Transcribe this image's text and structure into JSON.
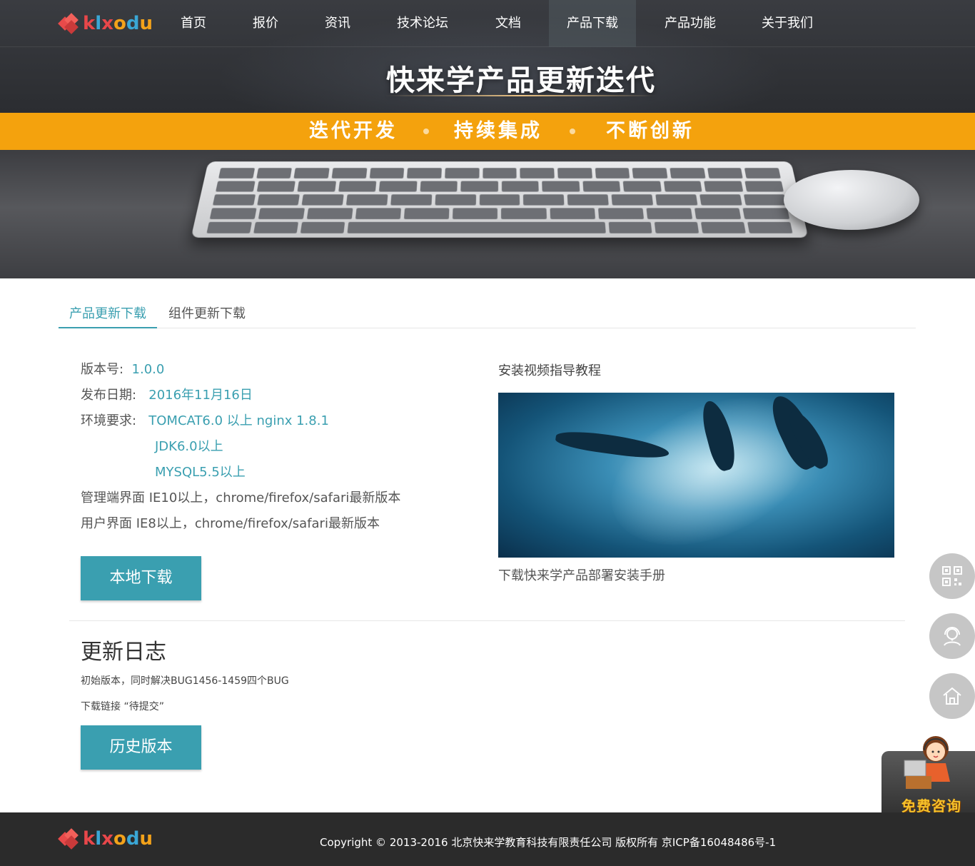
{
  "brand": {
    "logo_text": "klxodu"
  },
  "nav": {
    "items": [
      {
        "label": "首页"
      },
      {
        "label": "报价"
      },
      {
        "label": "资讯"
      },
      {
        "label": "技术论坛"
      },
      {
        "label": "文档"
      },
      {
        "label": "产品下载",
        "active": true
      },
      {
        "label": "产品功能"
      },
      {
        "label": "关于我们"
      }
    ]
  },
  "banner": {
    "title": "快来学产品更新迭代",
    "slogans": [
      "迭代开发",
      "持续集成",
      "不断创新"
    ],
    "accent_color": "#f4a20d"
  },
  "tabs": [
    {
      "label": "产品更新下载",
      "active": true
    },
    {
      "label": "组件更新下载"
    }
  ],
  "version_info": {
    "version_label": "版本号:",
    "version_value": "1.0.0",
    "date_label": "发布日期:",
    "date_value": "2016年11月16日",
    "env_label": "环境要求:",
    "env_values": [
      "TOMCAT6.0 以上 nginx 1.8.1",
      "JDK6.0以上",
      "MYSQL5.5以上"
    ],
    "admin_ui": "管理端界面 IE10以上，chrome/firefox/safari最新版本",
    "user_ui": "用户界面 IE8以上，chrome/firefox/safari最新版本",
    "download_button": "本地下载"
  },
  "video": {
    "title": "安装视频指导教程",
    "caption": "下载快来学产品部署安装手册"
  },
  "changelog": {
    "title": "更新日志",
    "lines": [
      "初始版本，同时解决BUG1456-1459四个BUG",
      "下载链接 “待提交”"
    ],
    "history_button": "历史版本"
  },
  "side": {
    "icons": [
      "qrcode-icon",
      "customer-service-icon",
      "home-icon"
    ],
    "consult_label": "免费咨询"
  },
  "footer": {
    "copyright": "Copyright © 2013-2016  北京快来学教育科技有限责任公司 版权所有    京ICP备16048486号-1"
  },
  "colors": {
    "primary": "#3a9fb0",
    "footer_bg": "#2b2b2b",
    "side_button": "#c6c6c6"
  }
}
